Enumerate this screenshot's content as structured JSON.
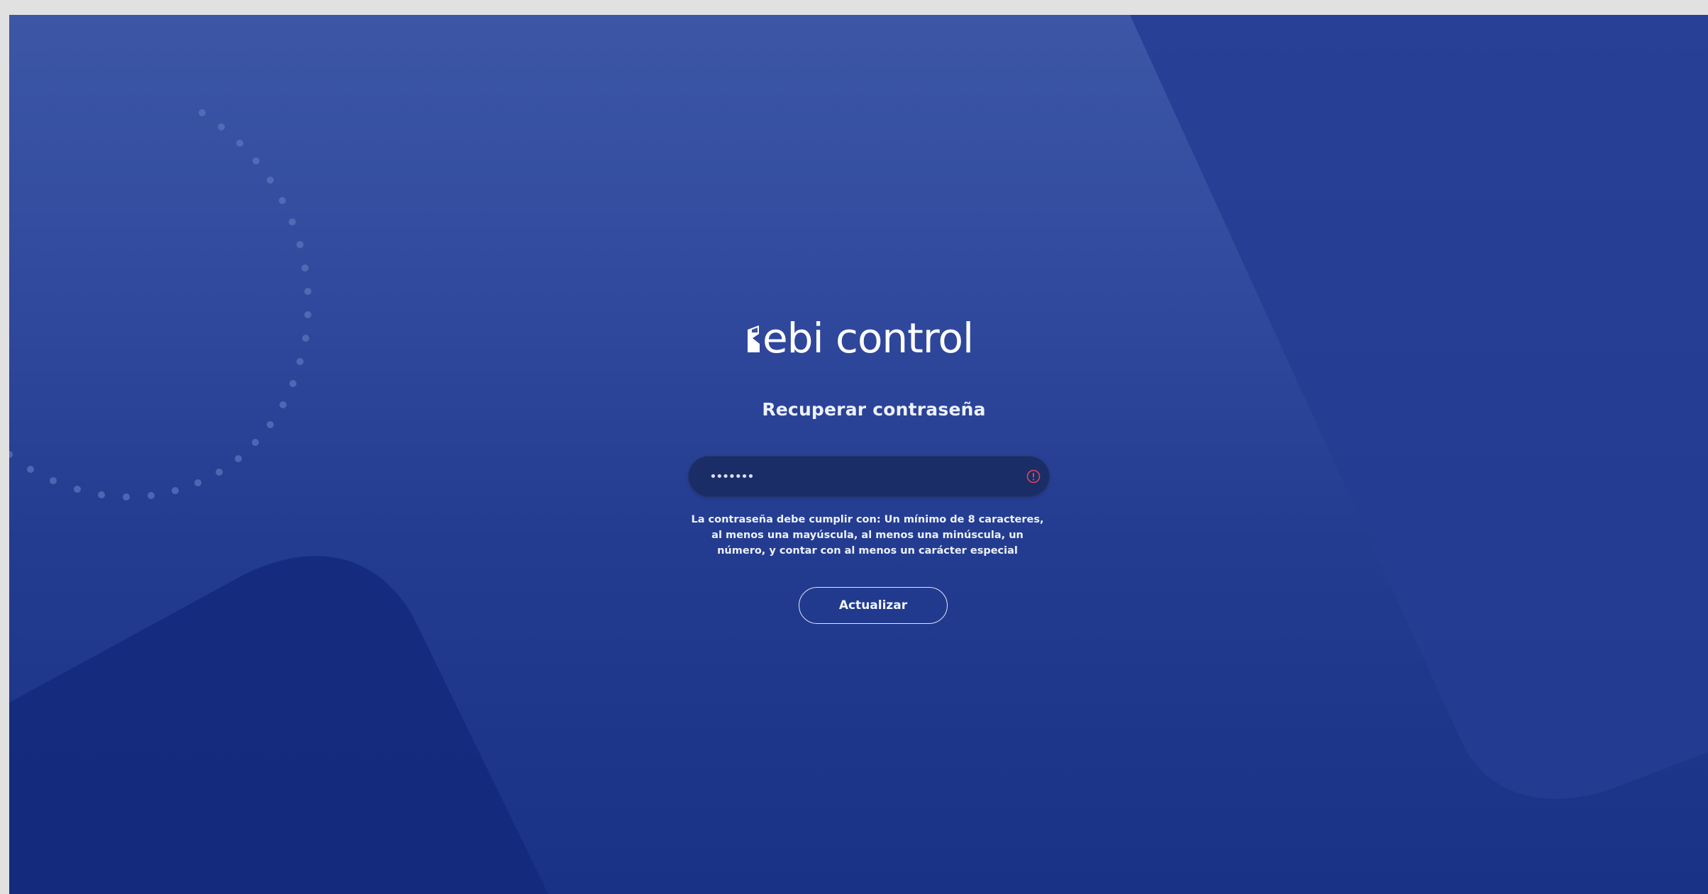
{
  "brand": {
    "logo_text": "ebi control"
  },
  "page": {
    "title": "Recuperar contraseña"
  },
  "password_field": {
    "value": "•••••••",
    "status_icon": "alert-circle-icon"
  },
  "hint": {
    "text": "La contraseña debe cumplir con: Un mínimo de 8 caracteres, al menos una mayúscula, al menos una minúscula, un número, y contar con al menos un carácter especial"
  },
  "actions": {
    "update_label": "Actualizar"
  },
  "colors": {
    "background_top": "#3d57a6",
    "background_bottom": "#1a3285",
    "input_background": "#1b2d66",
    "alert": "#e0435a"
  }
}
